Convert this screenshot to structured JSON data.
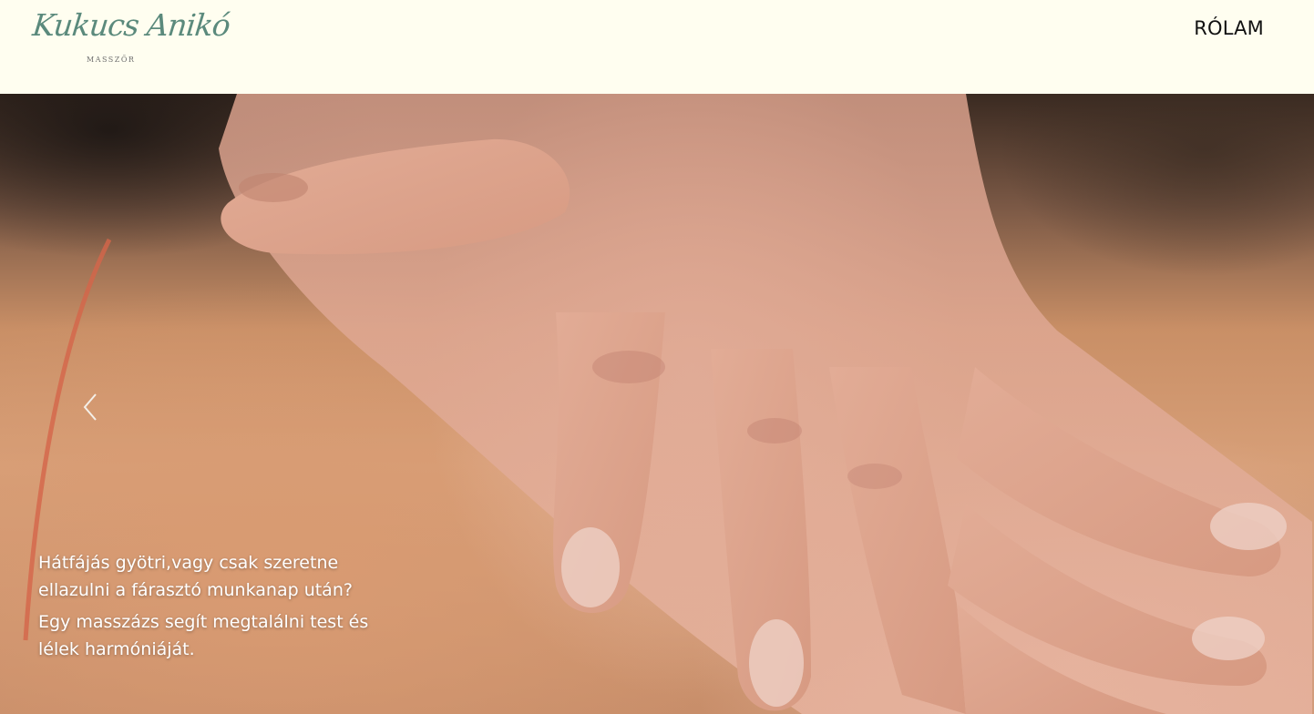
{
  "logo": {
    "name": "Kukucs Anikó",
    "tagline": "MASSZŐR"
  },
  "nav": {
    "about_label": "RÓLAM"
  },
  "hero": {
    "prev_icon": "chevron-left-icon",
    "caption_line1": "Hátfájás gyötri,vagy csak szeretne ellazulni a fárasztó munkanap után?",
    "caption_line2": "Egy masszázs segít megtalálni test és lélek harmóniáját."
  },
  "colors": {
    "header_bg": "#fffef0",
    "logo_green": "#5b8a7c",
    "caption_text": "#ffffff"
  }
}
